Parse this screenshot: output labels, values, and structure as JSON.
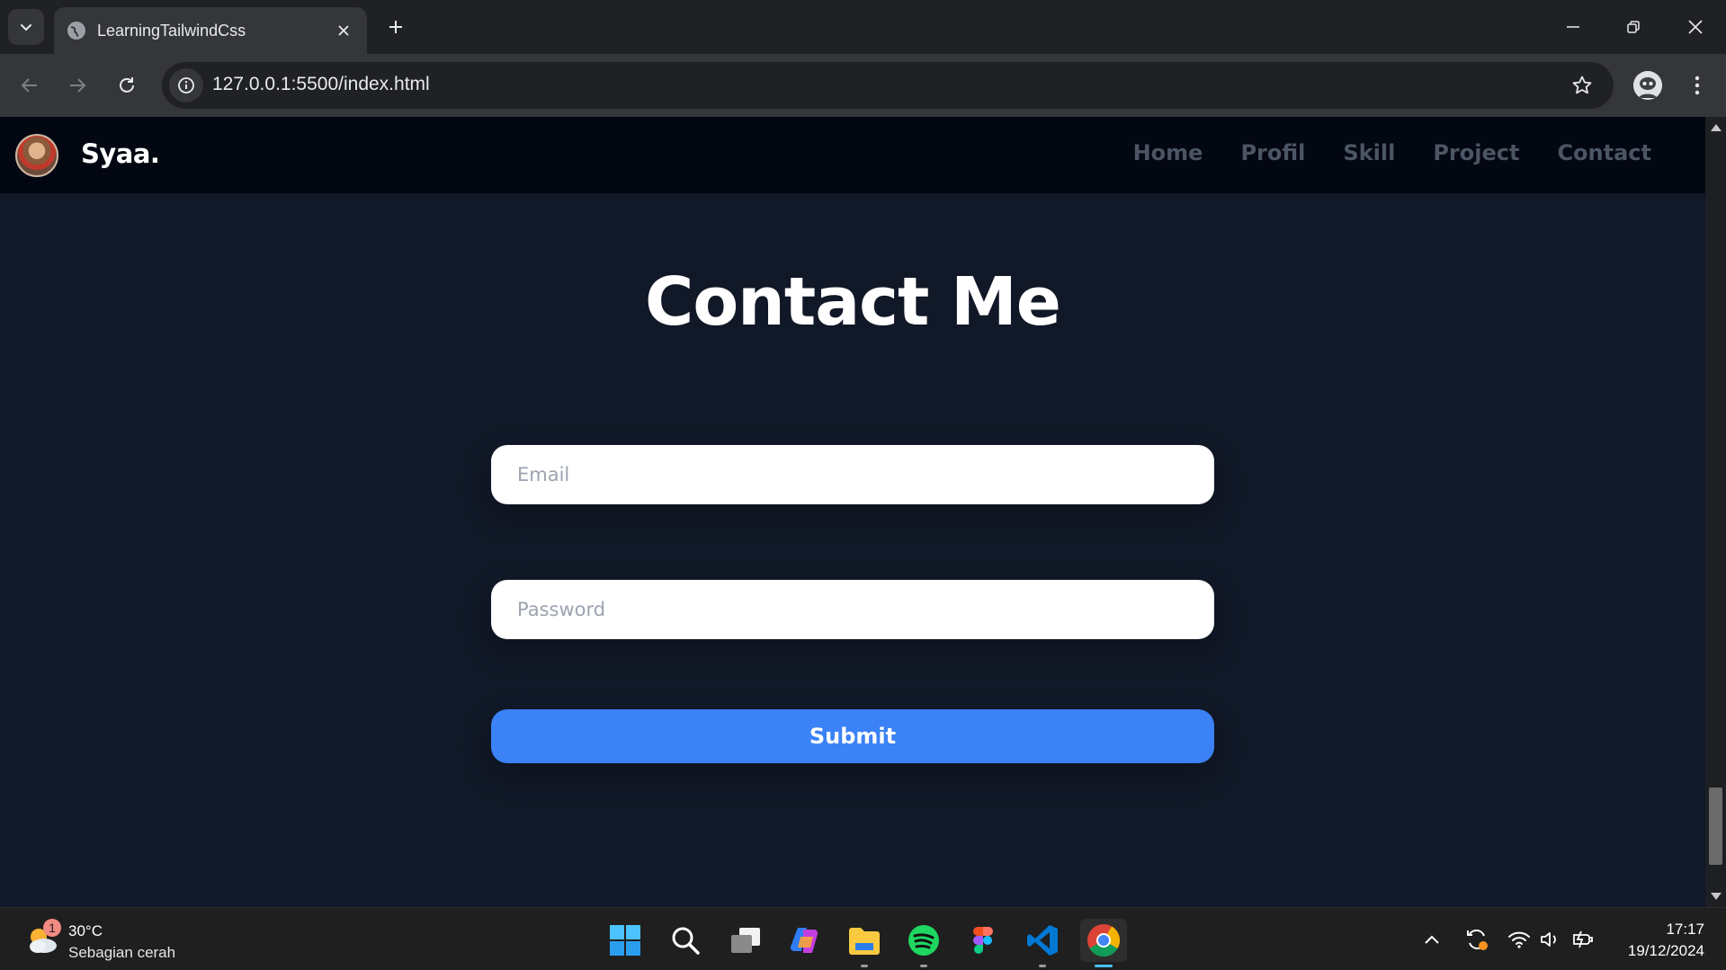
{
  "browser": {
    "tab_title": "LearningTailwindCss",
    "url_host": "127.0.0.1",
    "url_path": ":5500/index.html"
  },
  "site": {
    "brand": "Syaa.",
    "nav_links": [
      "Home",
      "Profil",
      "Skill",
      "Project",
      "Contact"
    ]
  },
  "contact": {
    "title": "Contact Me",
    "email_placeholder": "Email",
    "password_placeholder": "Password",
    "submit_label": "Submit"
  },
  "taskbar": {
    "weather_temp": "30°C",
    "weather_condition": "Sebagian cerah",
    "weather_badge": "1",
    "time": "17:17",
    "date": "19/12/2024",
    "apps": [
      "start-icon",
      "search-icon",
      "task-view-icon",
      "copilot-icon",
      "file-explorer-icon",
      "spotify-icon",
      "figma-icon",
      "vscode-icon",
      "chrome-icon"
    ]
  },
  "colors": {
    "page_bg": "#111827",
    "nav_bg": "#030712",
    "accent": "#3b82f6",
    "nav_link": "#4b5563"
  }
}
